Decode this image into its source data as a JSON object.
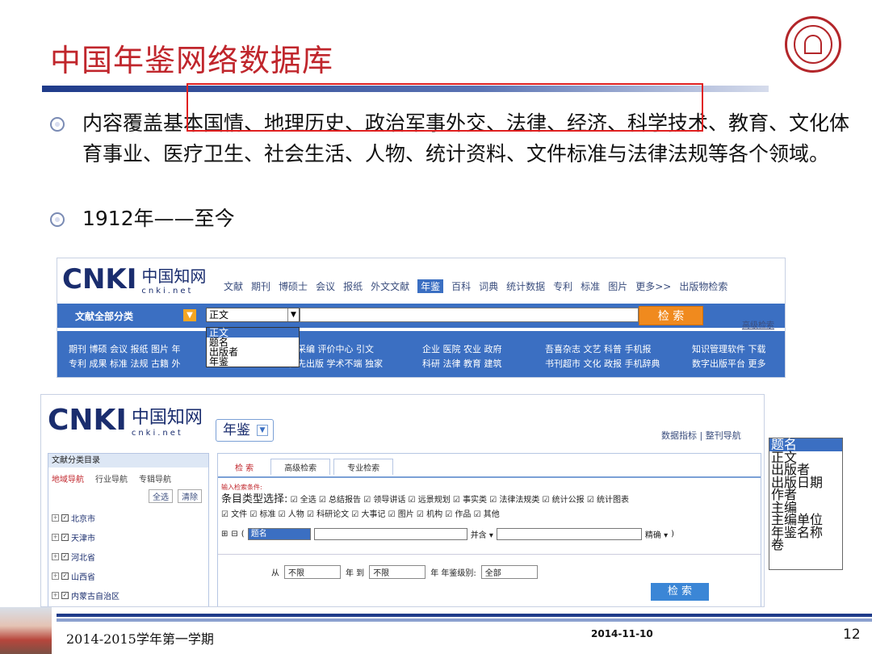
{
  "slide": {
    "title": "中国年鉴网络数据库",
    "bullets": [
      "内容覆盖基本国情、地理历史、政治军事外交、法律、经济、科学技术、教育、文化体育事业、医疗卫生、社会生活、人物、统计资料、文件标准与法律法规等各个领域。",
      "1912年——至今"
    ]
  },
  "cnki_top": {
    "logo_text": "CNKI",
    "logo_cn": "中国知网",
    "logo_sub": "cnki.net",
    "nav": [
      "文献",
      "期刊",
      "博硕士",
      "会议",
      "报纸",
      "外文文献",
      "年鉴",
      "百科",
      "词典",
      "统计数据",
      "专利",
      "标准",
      "图片",
      "更多>>",
      "出版物检索"
    ],
    "active_nav": "年鉴",
    "category_label": "文献全部分类",
    "field_value": "正文",
    "search_label": "检 索",
    "advanced_label": "高级检索",
    "dropdown_options": [
      "正文",
      "题名",
      "出版者",
      "年鉴"
    ],
    "dropdown_selected": "正文",
    "link_row1": "期刊 博硕 会议 报纸 图片 年",
    "link_row2": "专利 成果 标准 法规 古籍 外",
    "link_row1b": "刊采编 评价中心 引文",
    "link_row2b": "优先出版 学术不端 独家",
    "link_row1c": "企业 医院 农业 政府",
    "link_row2c": "科研 法律 教育 建筑",
    "link_row1d": "吾喜杂志 文艺 科普 手机报",
    "link_row2d": "书刊超市 文化 政报 手机辞典",
    "link_row1e": "知识管理软件 下载",
    "link_row2e": "数字出版平台 更多"
  },
  "cnki_yearbook": {
    "db_select": "年鉴",
    "top_links": "数据指标 | 整刊导航",
    "sidebar_title": "文献分类目录",
    "sidebar_tabs": [
      "地域导航",
      "行业导航",
      "专辑导航"
    ],
    "select_all": "全选",
    "clear": "清除",
    "provinces": [
      "北京市",
      "天津市",
      "河北省",
      "山西省",
      "内蒙古自治区"
    ],
    "tabs": [
      "检 索",
      "高级检索",
      "专业检索"
    ],
    "hint": "输入检索条件:",
    "type_label": "条目类型选择:",
    "types_row1": "☑ 全选 ☑ 总结报告 ☑ 领导讲话 ☑ 远景规划 ☑ 事实类 ☑ 法律法规类 ☑ 统计公报 ☑ 统计图表",
    "types_row2": "☑ 文件 ☑ 标准 ☑ 人物 ☑ 科研论文 ☑ 大事记 ☑ 图片 ☑ 机构 ☑ 作品 ☑ 其他",
    "field_value": "题名",
    "combine": "并含 ▾",
    "precise": "精确 ▾",
    "from": "从",
    "from_value": "不限",
    "year_to": "年 到",
    "to_value": "不限",
    "year_level": "年 年鉴级别:",
    "level_value": "全部",
    "search_label": "检 索"
  },
  "side_list": {
    "options": [
      "题名",
      "正文",
      "出版者",
      "出版日期",
      "作者",
      "主编",
      "主编单位",
      "年鉴名称",
      "卷"
    ],
    "selected": "题名"
  },
  "footer": {
    "term": "2014-2015学年第一学期",
    "date": "2014-11-10",
    "page": "12"
  }
}
